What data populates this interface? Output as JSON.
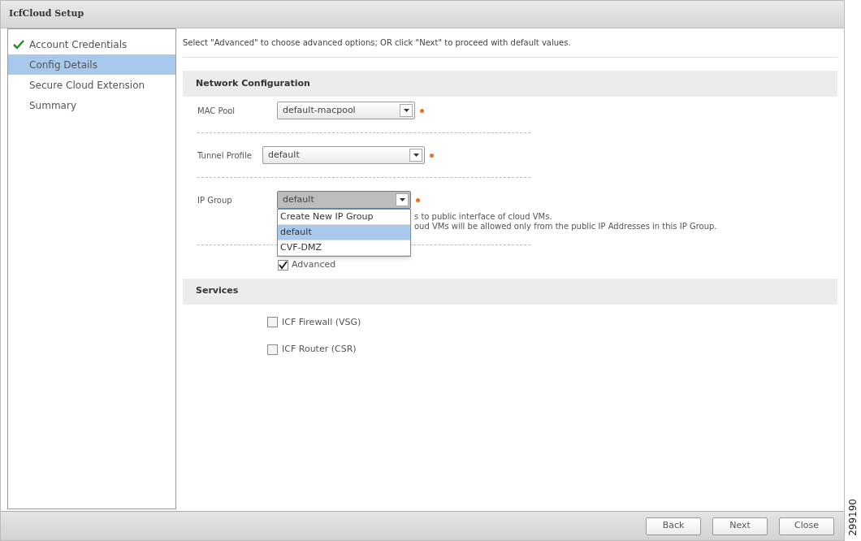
{
  "window": {
    "title": "IcfCloud Setup"
  },
  "steps": [
    {
      "label": "Account Credentials",
      "done": true,
      "selected": false
    },
    {
      "label": "Config Details",
      "done": false,
      "selected": true
    },
    {
      "label": "Secure Cloud Extension",
      "done": false,
      "selected": false
    },
    {
      "label": "Summary",
      "done": false,
      "selected": false
    }
  ],
  "instruction": "Select \"Advanced\" to choose advanced options; OR click \"Next\" to proceed with default values.",
  "network_section": {
    "title": "Network Configuration",
    "fields": [
      {
        "label": "MAC Pool",
        "value": "default-macpool",
        "required": true,
        "open": false
      },
      {
        "label": "Tunnel Profile",
        "value": "default",
        "required": true,
        "open": false
      },
      {
        "label": "IP Group",
        "value": "default",
        "required": true,
        "open": true,
        "hint_lines": [
          "s to public interface of cloud VMs.",
          "oud VMs will be allowed only from the public IP Addresses in this IP Group."
        ],
        "options": [
          {
            "label": "Create New IP Group",
            "selected": false
          },
          {
            "label": "default",
            "selected": true
          },
          {
            "label": "CVF-DMZ",
            "selected": false
          }
        ]
      }
    ],
    "advanced": {
      "label": "Advanced",
      "checked": true
    }
  },
  "services_section": {
    "title": "Services",
    "options": [
      {
        "label": "ICF Firewall (VSG)",
        "checked": false
      },
      {
        "label": "ICF Router (CSR)",
        "checked": false
      }
    ]
  },
  "buttons": [
    "Back",
    "Next",
    "Close"
  ],
  "figure_number": "299190"
}
